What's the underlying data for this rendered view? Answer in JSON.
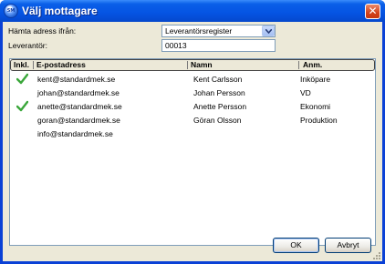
{
  "window": {
    "title": "Välj mottagare",
    "icon_text": "SM"
  },
  "form": {
    "source_label": "Hämta adress ifrån:",
    "source_value": "Leverantörsregister",
    "supplier_label": "Leverantör:",
    "supplier_value": "00013"
  },
  "list": {
    "columns": [
      "Inkl.",
      "E-postadress",
      "Namn",
      "Anm."
    ],
    "rows": [
      {
        "included": true,
        "email": "kent@standardmek.se",
        "name": "Kent Carlsson",
        "note": "Inköpare"
      },
      {
        "included": false,
        "email": "johan@standardmek.se",
        "name": "Johan Persson",
        "note": "VD"
      },
      {
        "included": true,
        "email": "anette@standardmek.se",
        "name": "Anette Persson",
        "note": "Ekonomi"
      },
      {
        "included": false,
        "email": "goran@standardmek.se",
        "name": "Göran Olsson",
        "note": "Produktion"
      },
      {
        "included": false,
        "email": "info@standardmek.se",
        "name": "",
        "note": ""
      }
    ]
  },
  "buttons": {
    "ok": "OK",
    "cancel": "Avbryt"
  },
  "colors": {
    "titlebar": "#0554e3",
    "check": "#3aa63a",
    "face": "#ece9d8"
  }
}
